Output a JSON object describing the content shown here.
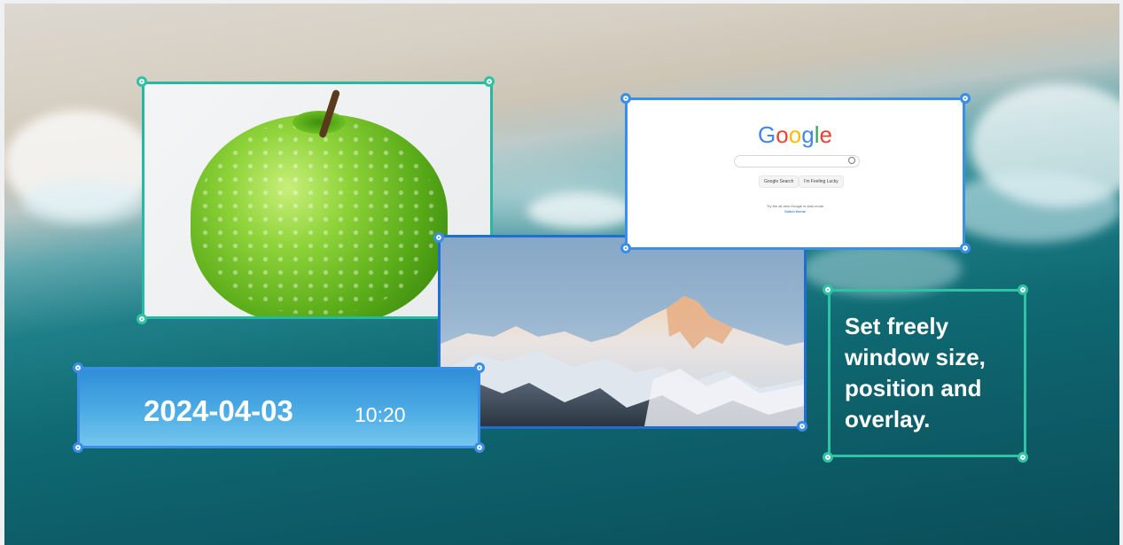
{
  "windows": {
    "date_widget": {
      "date": "2024-04-03",
      "time": "10:20"
    },
    "text_widget": {
      "caption": "Set freely window size, position and overlay."
    },
    "google_page": {
      "logo": [
        "G",
        "o",
        "o",
        "g",
        "l",
        "e"
      ],
      "buttons": [
        "Google Search",
        "I'm Feeling Lucky"
      ],
      "footer_text": "Try the all-new Google in dark mode",
      "footer_link": "Switch theme"
    }
  },
  "colors": {
    "teal_border": "#26b9a1",
    "blue_border": "#3a8ee6",
    "date_gradient_top": "#2f8fd8",
    "date_gradient_bottom": "#74c6ee",
    "google_blue": "#4285f4",
    "google_red": "#ea4335",
    "google_yellow": "#fbbc05",
    "google_green": "#34a853"
  },
  "icons": [
    "resize-handle",
    "search-icon"
  ]
}
